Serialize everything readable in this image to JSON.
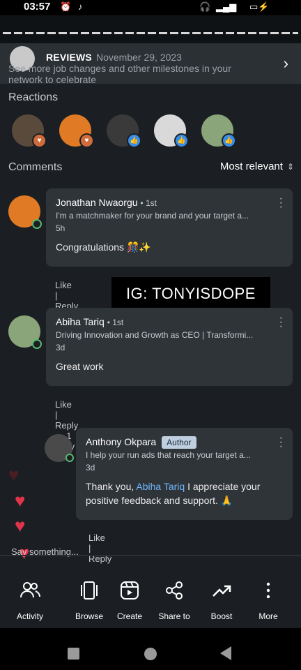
{
  "status_bar": {
    "time": "03:57"
  },
  "banner": {
    "title": "REVIEWS",
    "date": "November 29, 2023",
    "text": "See more job changes and other milestones in your network to celebrate"
  },
  "reactions": {
    "title": "Reactions"
  },
  "comments": {
    "title": "Comments",
    "sort_label": "Most relevant",
    "items": [
      {
        "name": "Jonathan Nwaorgu",
        "degree": "1st",
        "headline": "I'm a matchmaker for your brand and your target a...",
        "time": "5h",
        "body": "Congratulations 🎊✨",
        "like": "Like",
        "reply": "Reply"
      },
      {
        "name": "Abiha Tariq",
        "degree": "1st",
        "headline": "Driving Innovation and Growth as CEO | Transformi...",
        "time": "3d",
        "body": "Great work",
        "like": "Like",
        "reply": "Reply",
        "replies": "1 reply"
      },
      {
        "name": "Anthony Okpara",
        "badge": "Author",
        "headline": "I help your run ads that reach your target a...",
        "time": "3d",
        "body_prefix": "Thank you,",
        "mention": "Abiha Tariq",
        "body_suffix": "I appreciate your positive feedback and support. 🙏",
        "like": "Like",
        "reply": "Reply"
      }
    ]
  },
  "watermark": "IG: TONYISDOPE",
  "composer_placeholder": "Say something...",
  "bottom_nav": [
    {
      "label": "Activity",
      "icon": "people-icon"
    },
    {
      "label": "Browse",
      "icon": "browse-icon"
    },
    {
      "label": "Create",
      "icon": "create-icon"
    },
    {
      "label": "Share to",
      "icon": "share-icon"
    },
    {
      "label": "Boost",
      "icon": "boost-icon"
    },
    {
      "label": "More",
      "icon": "more-icon"
    }
  ],
  "colors": {
    "background": "#1b1f23",
    "card": "#2f3439",
    "link": "#70b5f9",
    "heart": "#e0344a"
  }
}
